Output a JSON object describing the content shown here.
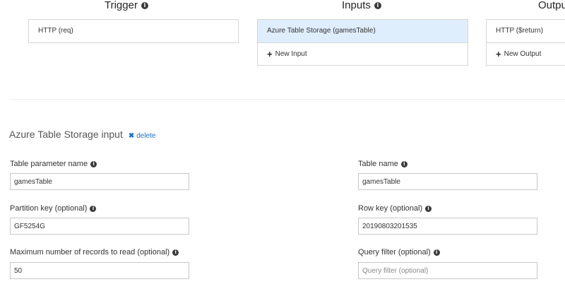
{
  "columns": {
    "trigger": {
      "title": "Trigger",
      "items": [
        "HTTP (req)"
      ]
    },
    "inputs": {
      "title": "Inputs",
      "items": [
        "Azure Table Storage (gamesTable)"
      ],
      "new_label": "New Input"
    },
    "outputs": {
      "title": "Outpu",
      "items": [
        "HTTP ($return)"
      ],
      "new_label": "New Output"
    }
  },
  "section": {
    "title": "Azure Table Storage input",
    "delete_label": "delete"
  },
  "fields": {
    "table_param": {
      "label": "Table parameter name",
      "value": "gamesTable"
    },
    "table_name": {
      "label": "Table name",
      "value": "gamesTable"
    },
    "partition_key": {
      "label": "Partition key (optional)",
      "value": "GF5254G"
    },
    "row_key": {
      "label": "Row key (optional)",
      "value": "20190803201535"
    },
    "max_records": {
      "label": "Maximum number of records to read (optional)",
      "value": "50"
    },
    "query_filter": {
      "label": "Query filter (optional)",
      "value": "",
      "placeholder": "Query filter (optional)"
    }
  },
  "icons": {
    "info": "info-icon",
    "plus": "plus-icon",
    "delete": "x-icon"
  },
  "colors": {
    "selected_bg": "#dfeefd",
    "link": "#1b71c9",
    "border": "#d6d6d6"
  }
}
